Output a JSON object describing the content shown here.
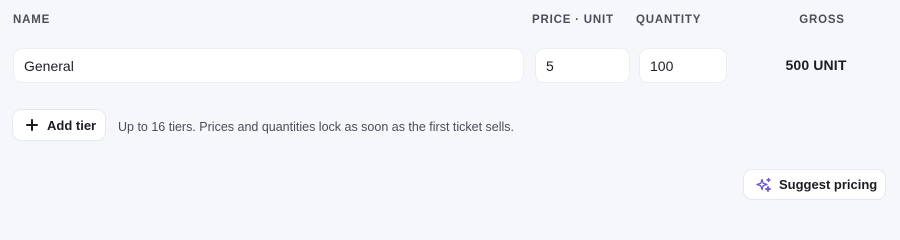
{
  "table": {
    "headers": {
      "name": "NAME",
      "price": "PRICE · UNIT",
      "quantity": "QUANTITY",
      "gross": "GROSS"
    },
    "tiers": [
      {
        "name": "General",
        "price": "5",
        "quantity": "100",
        "gross": "500 UNIT"
      }
    ]
  },
  "actions": {
    "add_tier_label": "Add tier",
    "add_tier_hint": "Up to 16 tiers. Prices and quantities lock as soon as the first ticket sells.",
    "suggest_pricing_label": "Suggest pricing"
  },
  "icons": {
    "add": "plus-icon",
    "suggest": "sparkle-icon"
  },
  "colors": {
    "background": "#f6f7fb",
    "sparkle_accent": "#6f55d6"
  }
}
